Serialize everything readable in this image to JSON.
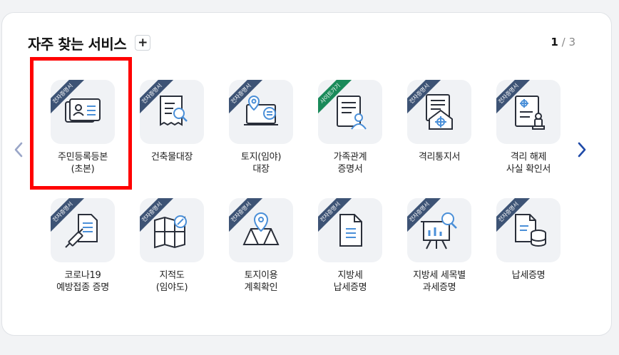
{
  "section": {
    "title": "자주 찾는 서비스",
    "add_label": "+",
    "page_current": "1",
    "page_sep": " / ",
    "page_total": "3"
  },
  "tiles": [
    {
      "badge": "전자증명서",
      "line1": "주민등록등본",
      "line2": "(초본)"
    },
    {
      "badge": "전자증명서",
      "line1": "건축물대장",
      "line2": ""
    },
    {
      "badge": "전자증명서",
      "line1": "토지(임야)",
      "line2": "대장"
    },
    {
      "badge": "사이트가기",
      "line1": "가족관계",
      "line2": "증명서"
    },
    {
      "badge": "전자증명서",
      "line1": "격리통지서",
      "line2": ""
    },
    {
      "badge": "전자증명서",
      "line1": "격리 해제",
      "line2": "사실 확인서"
    },
    {
      "badge": "전자증명서",
      "line1": "코로나19",
      "line2": "예방접종 증명"
    },
    {
      "badge": "전자증명서",
      "line1": "지적도",
      "line2": "(임야도)"
    },
    {
      "badge": "전자증명서",
      "line1": "토지이용",
      "line2": "계획확인"
    },
    {
      "badge": "전자증명서",
      "line1": "지방세",
      "line2": "납세증명"
    },
    {
      "badge": "전자증명서",
      "line1": "지방세 세목별",
      "line2": "과세증명"
    },
    {
      "badge": "전자증명서",
      "line1": "납세증명",
      "line2": ""
    }
  ],
  "icons": [
    "id-card-icon",
    "building-register-icon",
    "land-register-icon",
    "family-relation-icon",
    "quarantine-notice-icon",
    "quarantine-release-icon",
    "vaccination-icon",
    "cadastral-map-icon",
    "land-use-plan-icon",
    "local-tax-icon",
    "tax-item-icon",
    "tax-payment-icon"
  ],
  "colors": {
    "ribbon": "#3d5375",
    "ribbon_site": "#1a8a5a",
    "accent": "#4a8fd8",
    "highlight": "#ff0000",
    "arrow": "#1f4aa8"
  }
}
